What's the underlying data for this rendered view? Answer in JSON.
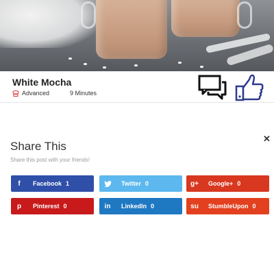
{
  "recipe": {
    "title": "White Mocha",
    "difficulty": "Advanced",
    "time": "9 Minutes"
  },
  "share": {
    "title": "Share This",
    "subtitle": "Share this post with your friends!",
    "close_glyph": "✕",
    "buttons": [
      {
        "network": "Facebook",
        "count": "1",
        "icon": "f",
        "color": "#2f4fa8"
      },
      {
        "network": "Twitter",
        "count": "0",
        "icon": "t",
        "color": "#5cb8ee"
      },
      {
        "network": "Google+",
        "count": "0",
        "icon": "g+",
        "color": "#d8381f"
      },
      {
        "network": "Pinterest",
        "count": "0",
        "icon": "p",
        "color": "#c8191b"
      },
      {
        "network": "LinkedIn",
        "count": "0",
        "icon": "in",
        "color": "#1f78c2"
      },
      {
        "network": "StumbleUpon",
        "count": "0",
        "icon": "su",
        "color": "#e2401f"
      }
    ]
  },
  "icons": {
    "comments": "comments-icon",
    "like": "thumbs-up-icon",
    "difficulty": "chef-hat-icon"
  }
}
